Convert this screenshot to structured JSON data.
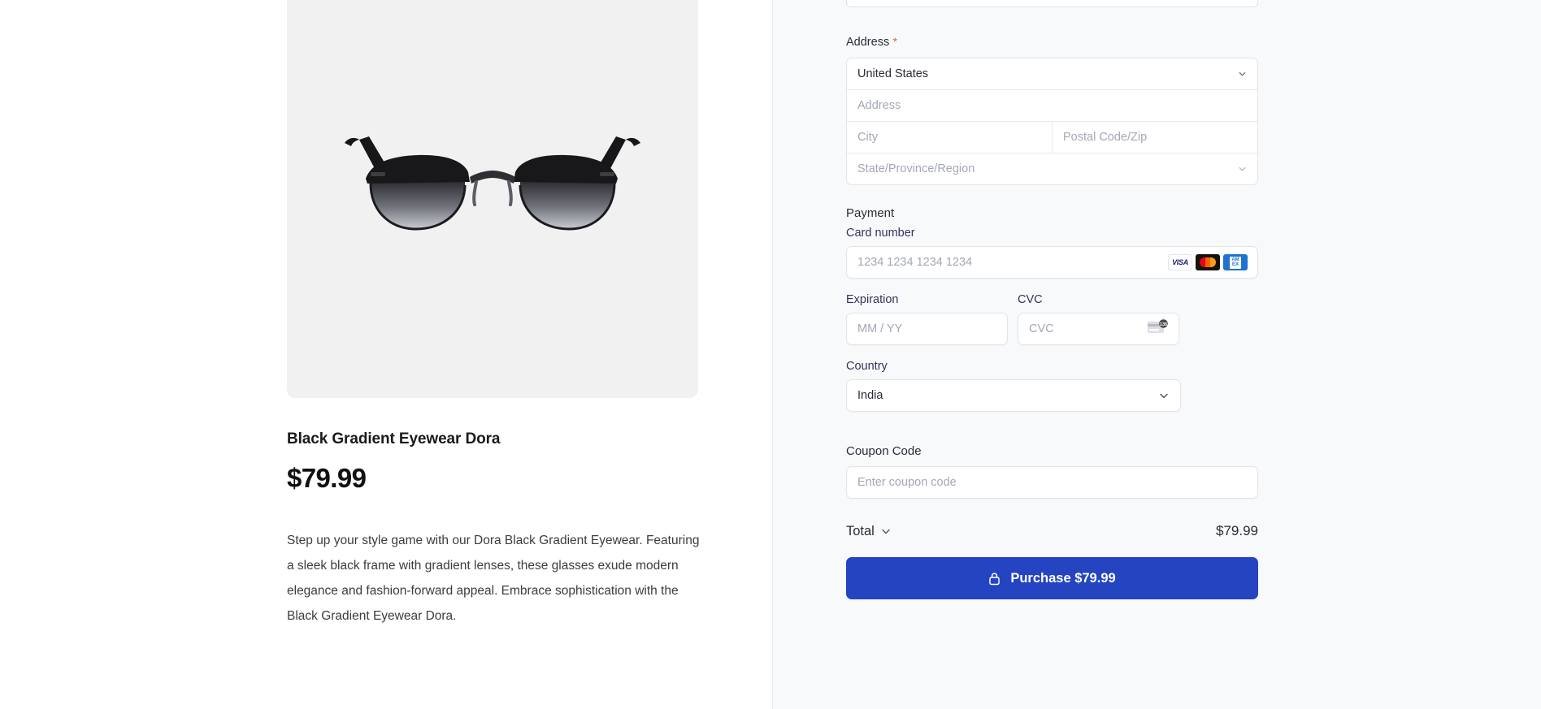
{
  "product": {
    "title": "Black Gradient Eyewear Dora",
    "price": "$79.99",
    "description": "Step up your style game with our Dora Black Gradient Eyewear. Featuring a sleek black frame with gradient lenses, these glasses exude modern elegance and fashion-forward appeal. Embrace sophistication with the Black Gradient Eyewear Dora.",
    "image_alt": "black-gradient-sunglasses"
  },
  "checkout": {
    "address": {
      "label": "Address",
      "required_marker": "*",
      "country_value": "United States",
      "street_placeholder": "Address",
      "city_placeholder": "City",
      "postal_placeholder": "Postal Code/Zip",
      "state_placeholder": "State/Province/Region"
    },
    "payment": {
      "section_label": "Payment",
      "card_number_label": "Card number",
      "card_number_placeholder": "1234 1234 1234 1234",
      "card_brands": [
        "VISA",
        "mastercard",
        "AMEX"
      ],
      "expiration_label": "Expiration",
      "expiration_placeholder": "MM / YY",
      "cvc_label": "CVC",
      "cvc_placeholder": "CVC",
      "cvc_hint_digits": "135"
    },
    "country": {
      "label": "Country",
      "value": "India"
    },
    "coupon": {
      "label": "Coupon Code",
      "placeholder": "Enter coupon code"
    },
    "total": {
      "label": "Total",
      "amount": "$79.99"
    },
    "purchase_button": {
      "label": "Purchase $79.99",
      "icon": "lock-icon",
      "color": "#2544c1"
    }
  },
  "colors": {
    "left_background": "#ffffff",
    "right_background": "#f8f9fb",
    "image_background": "#f1f1f1",
    "border": "#e2e4e9",
    "placeholder": "#a3a8b3",
    "accent_blue": "#2544c1",
    "required_orange": "#e8652b"
  }
}
